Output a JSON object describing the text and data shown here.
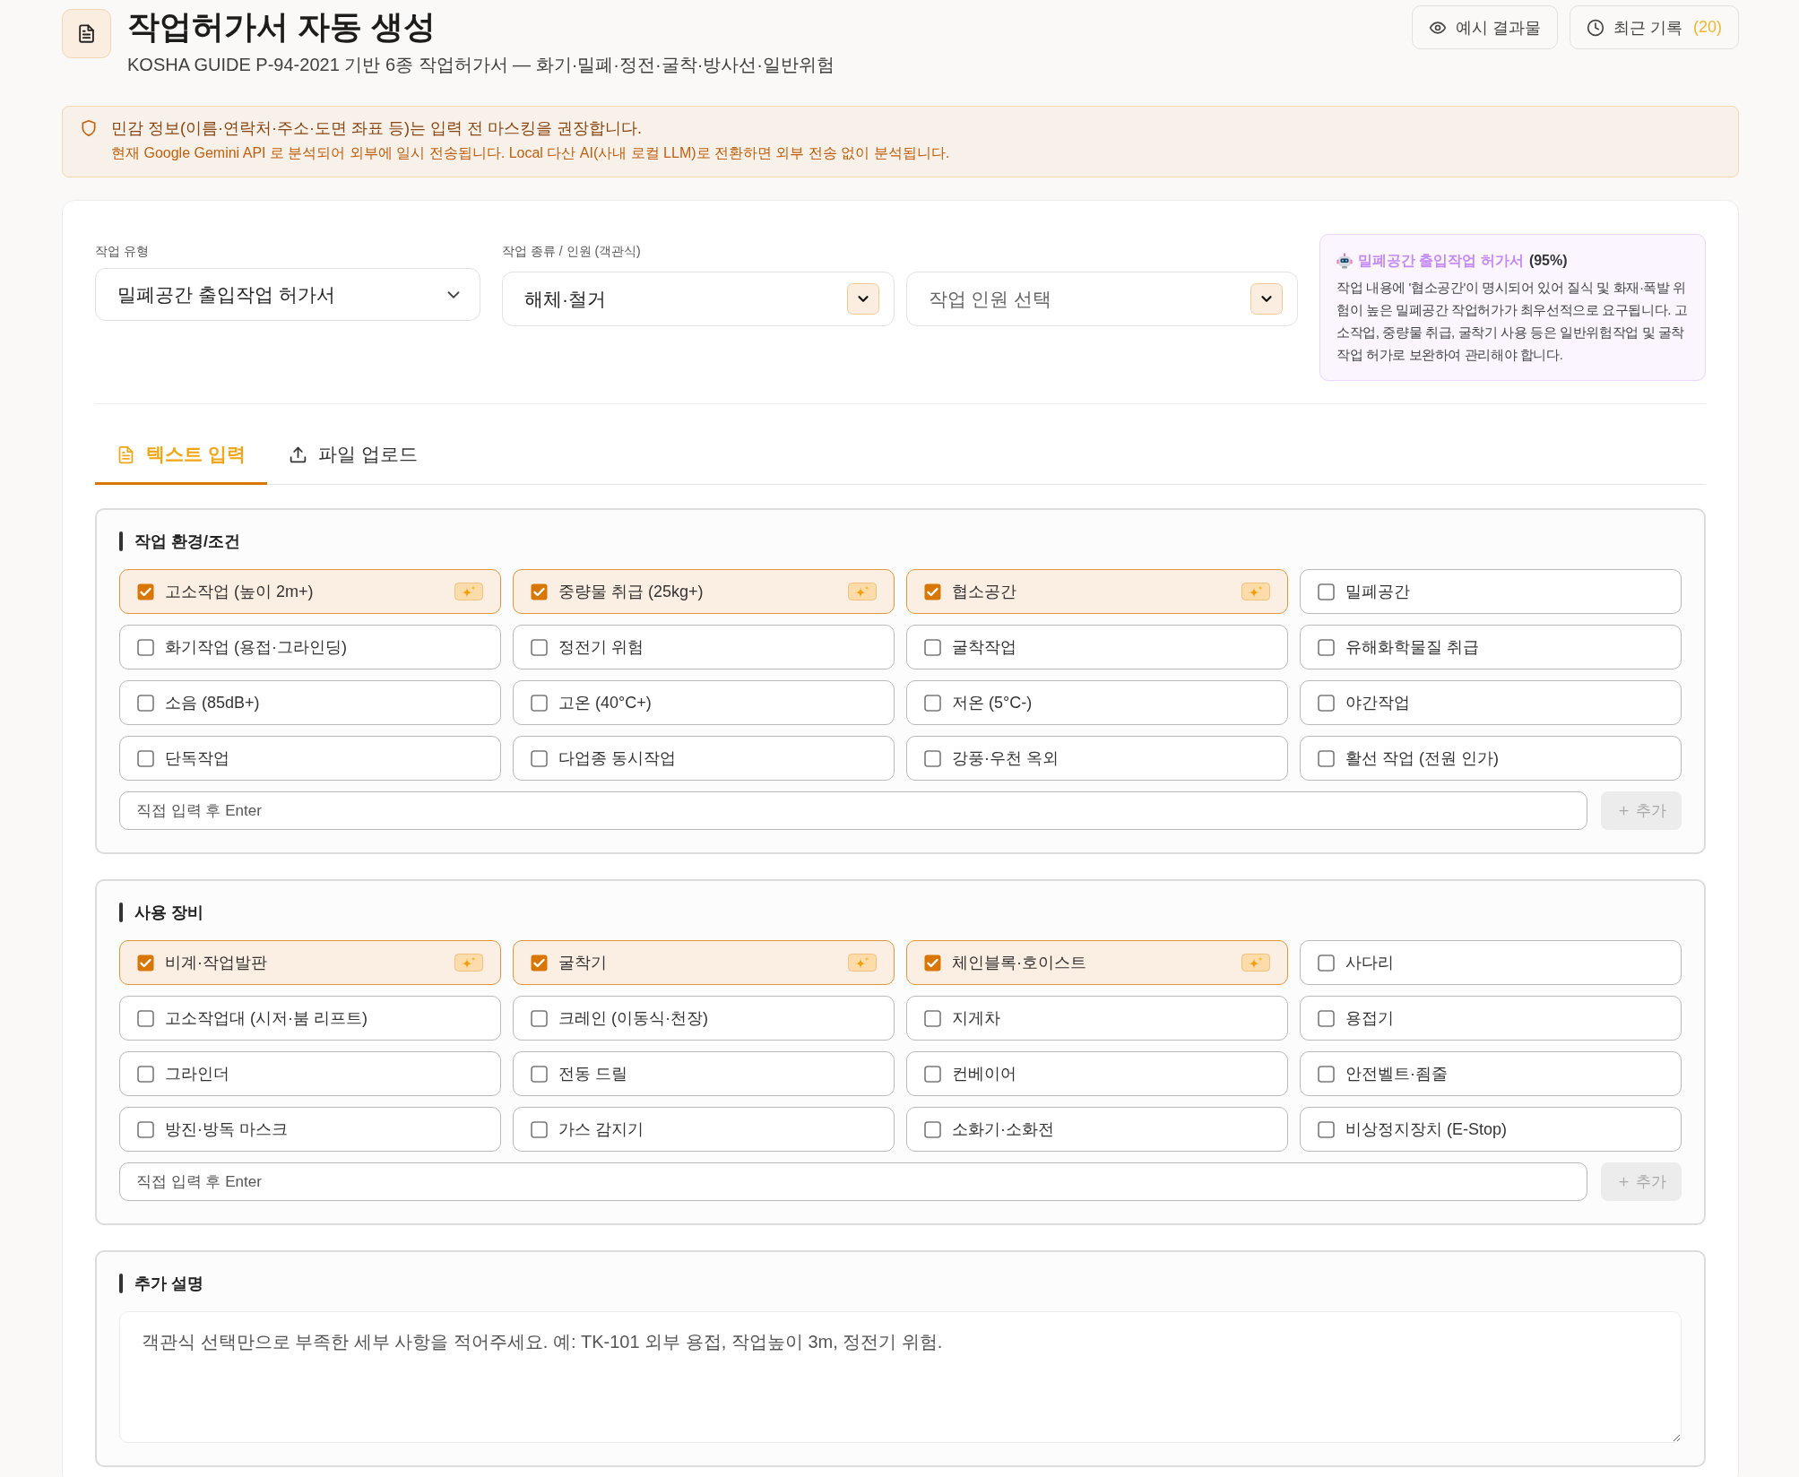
{
  "header": {
    "title": "작업허가서 자동 생성",
    "subtitle": "KOSHA GUIDE P-94-2021 기반 6종 작업허가서 — 화기·밀폐·정전·굴착·방사선·일반위험",
    "buttons": [
      {
        "kind": "example",
        "label": "예시 결과물"
      },
      {
        "kind": "history",
        "label": "최근 기록",
        "count": "(20)"
      }
    ]
  },
  "notice": {
    "message": "민감 정보(이름·연락처·주소·도면 좌표 등)는 입력 전 마스킹을 권장합니다.",
    "detail": "현재 Google Gemini API 로 분석되어 외부에 일시 전송됩니다. Local 다산 AI(사내 로컬 LLM)로 전환하면 외부 전송 없이 분석됩니다."
  },
  "form": {
    "work_type": {
      "label": "작업 유형",
      "value": "밀폐공간 출입작업 허가서"
    },
    "work_detail": {
      "label": "작업 종류 / 인원 (객관식)",
      "category": {
        "value": "해체·철거"
      },
      "workers": {
        "placeholder": "작업 인원 선택"
      }
    },
    "recommendation": {
      "title": "밀폐공간 출입작업 허가서",
      "confidence": "(95%)",
      "text": "작업 내용에 '협소공간'이 명시되어 있어 질식 및 화재·폭발 위험이 높은 밀폐공간 작업허가가 최우선적으로 요구됩니다. 고소작업, 중량물 취급, 굴착기 사용 등은 일반위험작업 및 굴착작업 허가로 보완하여 관리해야 합니다."
    }
  },
  "tabs": [
    {
      "kind": "text",
      "label": "텍스트 입력",
      "selected": true
    },
    {
      "kind": "upload",
      "label": "파일 업로드",
      "selected": false
    }
  ],
  "sections": [
    {
      "kind": "checklist",
      "title": "작업 환경/조건",
      "items": [
        {
          "label": "고소작업 (높이 2m+)",
          "checked": true,
          "recommended": true
        },
        {
          "label": "중량물 취급 (25kg+)",
          "checked": true,
          "recommended": true
        },
        {
          "label": "협소공간",
          "checked": true,
          "recommended": true
        },
        {
          "label": "밀폐공간",
          "checked": false,
          "recommended": false
        },
        {
          "label": "화기작업 (용접·그라인딩)",
          "checked": false,
          "recommended": false
        },
        {
          "label": "정전기 위험",
          "checked": false,
          "recommended": false
        },
        {
          "label": "굴착작업",
          "checked": false,
          "recommended": false
        },
        {
          "label": "유해화학물질 취급",
          "checked": false,
          "recommended": false
        },
        {
          "label": "소음 (85dB+)",
          "checked": false,
          "recommended": false
        },
        {
          "label": "고온 (40°C+)",
          "checked": false,
          "recommended": false
        },
        {
          "label": "저온 (5°C-)",
          "checked": false,
          "recommended": false
        },
        {
          "label": "야간작업",
          "checked": false,
          "recommended": false
        },
        {
          "label": "단독작업",
          "checked": false,
          "recommended": false
        },
        {
          "label": "다업종 동시작업",
          "checked": false,
          "recommended": false
        },
        {
          "label": "강풍·우천 옥외",
          "checked": false,
          "recommended": false
        },
        {
          "label": "활선 작업 (전원 인가)",
          "checked": false,
          "recommended": false
        }
      ],
      "custom_input": {
        "placeholder": "직접 입력 후 Enter"
      },
      "add_button": {
        "label": "추가",
        "disabled": true
      }
    },
    {
      "kind": "checklist",
      "title": "사용 장비",
      "items": [
        {
          "label": "비계·작업발판",
          "checked": true,
          "recommended": true
        },
        {
          "label": "굴착기",
          "checked": true,
          "recommended": true
        },
        {
          "label": "체인블록·호이스트",
          "checked": true,
          "recommended": true
        },
        {
          "label": "사다리",
          "checked": false,
          "recommended": false
        },
        {
          "label": "고소작업대 (시저·붐 리프트)",
          "checked": false,
          "recommended": false
        },
        {
          "label": "크레인 (이동식·천장)",
          "checked": false,
          "recommended": false
        },
        {
          "label": "지게차",
          "checked": false,
          "recommended": false
        },
        {
          "label": "용접기",
          "checked": false,
          "recommended": false
        },
        {
          "label": "그라인더",
          "checked": false,
          "recommended": false
        },
        {
          "label": "전동 드릴",
          "checked": false,
          "recommended": false
        },
        {
          "label": "컨베이어",
          "checked": false,
          "recommended": false
        },
        {
          "label": "안전벨트·죔줄",
          "checked": false,
          "recommended": false
        },
        {
          "label": "방진·방독 마스크",
          "checked": false,
          "recommended": false
        },
        {
          "label": "가스 감지기",
          "checked": false,
          "recommended": false
        },
        {
          "label": "소화기·소화전",
          "checked": false,
          "recommended": false
        },
        {
          "label": "비상정지장치 (E-Stop)",
          "checked": false,
          "recommended": false
        }
      ],
      "custom_input": {
        "placeholder": "직접 입력 후 Enter"
      },
      "add_button": {
        "label": "추가",
        "disabled": true
      }
    },
    {
      "kind": "text",
      "title": "추가 설명",
      "placeholder": "객관식 선택만으로 부족한 세부 사항을 적어주세요. 예: TK-101 외부 용접, 작업높이 3m, 정전기 위험."
    }
  ]
}
